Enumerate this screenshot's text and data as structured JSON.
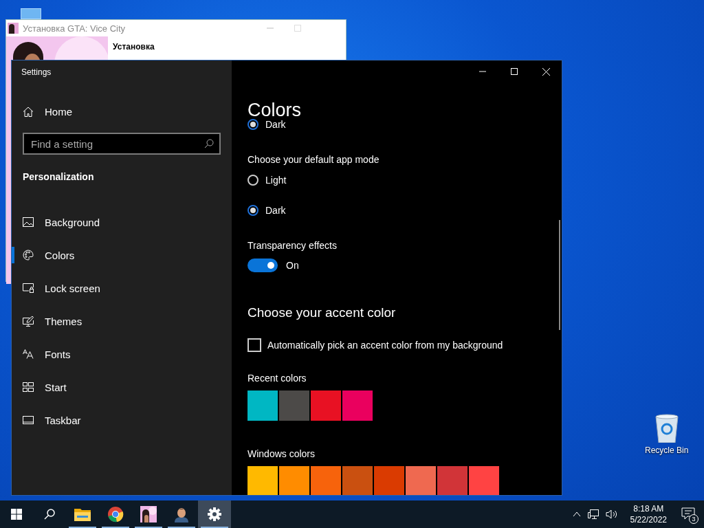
{
  "installer": {
    "title": "Установка GTA: Vice City",
    "heading": "Установка"
  },
  "settings": {
    "title": "Settings",
    "home": "Home",
    "search": {
      "placeholder": "Find a setting"
    },
    "section": "Personalization",
    "nav": [
      {
        "label": "Background",
        "selected": false
      },
      {
        "label": "Colors",
        "selected": true
      },
      {
        "label": "Lock screen",
        "selected": false
      },
      {
        "label": "Themes",
        "selected": false
      },
      {
        "label": "Fonts",
        "selected": false
      },
      {
        "label": "Start",
        "selected": false
      },
      {
        "label": "Taskbar",
        "selected": false
      }
    ],
    "page": {
      "title": "Colors",
      "windows_mode_tail": {
        "label": "Dark",
        "selected": true
      },
      "app_mode": {
        "label": "Choose your default app mode",
        "options": [
          {
            "label": "Light",
            "selected": false
          },
          {
            "label": "Dark",
            "selected": true
          }
        ]
      },
      "transparency": {
        "label": "Transparency effects",
        "on": true,
        "state": "On"
      },
      "accent": {
        "heading": "Choose your accent color",
        "auto_pick": {
          "label": "Automatically pick an accent color from my background",
          "checked": false
        },
        "recent": {
          "label": "Recent colors",
          "colors": [
            {
              "color": "#00b7c3"
            },
            {
              "color": "#4c4a48"
            },
            {
              "color": "#e81123"
            },
            {
              "color": "#ea005e"
            }
          ]
        },
        "windows": {
          "label": "Windows colors",
          "colors": [
            {
              "color": "#ffb900"
            },
            {
              "color": "#ff8c00"
            },
            {
              "color": "#f7630c"
            },
            {
              "color": "#ca5010"
            },
            {
              "color": "#da3b01"
            },
            {
              "color": "#ef6950"
            },
            {
              "color": "#d13438"
            },
            {
              "color": "#ff4343"
            }
          ]
        }
      }
    }
  },
  "desktop": {
    "recycle_bin": "Recycle Bin"
  },
  "taskbar": {
    "apps": [
      {
        "kind": "explorer",
        "selected": false
      },
      {
        "kind": "chrome",
        "selected": false
      },
      {
        "kind": "installer",
        "selected": false
      },
      {
        "kind": "game",
        "selected": false
      },
      {
        "kind": "settings",
        "selected": true
      }
    ],
    "time": "8:18 AM",
    "date": "5/22/2022",
    "notifications": "3"
  }
}
